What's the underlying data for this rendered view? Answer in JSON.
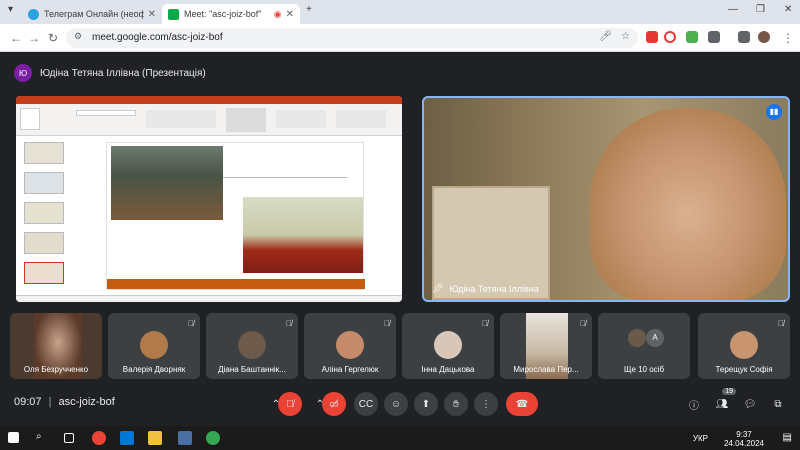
{
  "browser": {
    "tabs": [
      {
        "title": "Телеграм Онлайн (неофіцій",
        "active": false
      },
      {
        "title": "Meet: \"asc-joiz-bof\"",
        "active": true
      }
    ],
    "new_tab_label": "+",
    "url": "meet.google.com/asc-joiz-bof"
  },
  "meet": {
    "presenter": {
      "avatar_letter": "Ю",
      "name": "Юдіна Тетяна Іллівна (Презентація)"
    },
    "main_video": {
      "name": "Юдіна Тетяна Іллівна"
    },
    "participants": [
      {
        "name": "Оля Безручченко",
        "muted": false
      },
      {
        "name": "Валерія Дворняк",
        "muted": true
      },
      {
        "name": "Діана Баштаннік...",
        "muted": true
      },
      {
        "name": "Аліна Гергелюк",
        "muted": true
      },
      {
        "name": "Інна Дацькова",
        "muted": true
      },
      {
        "name": "Мирослава Пер...",
        "muted": true
      },
      {
        "name": "Ще 10 осіб",
        "muted": false,
        "avatar_letter": "А"
      },
      {
        "name": "Терещук Софія",
        "muted": true
      }
    ],
    "controls": {
      "time": "09:07",
      "separator": "|",
      "meeting_code": "asc-joiz-bof",
      "people_count": "19"
    }
  },
  "taskbar": {
    "lang": "УКР",
    "time": "9:37",
    "date": "24.04.2024"
  }
}
